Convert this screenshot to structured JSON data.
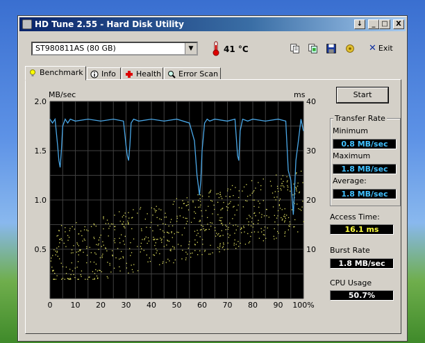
{
  "window": {
    "title": "HD Tune 2.55 - Hard Disk Utility",
    "controls": [
      "↓",
      "_",
      "□",
      "X"
    ]
  },
  "toolbar": {
    "drive": "ST980811AS (80 GB)",
    "temperature": "41 °C",
    "exit_label": "Exit",
    "icons": [
      "copy-text-icon",
      "copy-image-icon",
      "save-icon",
      "options-icon"
    ]
  },
  "tabs": [
    {
      "label": "Benchmark",
      "icon": "bulb-icon",
      "active": true
    },
    {
      "label": "Info",
      "icon": "info-icon",
      "active": false
    },
    {
      "label": "Health",
      "icon": "health-cross-icon",
      "active": false
    },
    {
      "label": "Error Scan",
      "icon": "magnifier-icon",
      "active": false
    }
  ],
  "start_label": "Start",
  "stats": {
    "group_title": "Transfer Rate",
    "minimum_label": "Minimum",
    "minimum_value": "0.8 MB/sec",
    "maximum_label": "Maximum",
    "maximum_value": "1.8 MB/sec",
    "average_label": "Average:",
    "average_value": "1.8 MB/sec",
    "access_label": "Access Time:",
    "access_value": "16.1 ms",
    "burst_label": "Burst Rate",
    "burst_value": "1.8 MB/sec",
    "cpu_label": "CPU Usage",
    "cpu_value": "50.7%"
  },
  "colors": {
    "transfer_line": "#4aa8e8",
    "access_points": "#e0e060",
    "plot_bg": "#000000",
    "grid": "#404040"
  },
  "chart_data": {
    "type": "line",
    "xlabel_ticks": [
      "0",
      "10",
      "20",
      "30",
      "40",
      "50",
      "60",
      "70",
      "80",
      "90",
      "100%"
    ],
    "y_left_label": "MB/sec",
    "y_left_ticks": [
      "2.0",
      "1.5",
      "1.0",
      "0.5"
    ],
    "y_left_range": [
      0,
      2.0
    ],
    "y_right_label": "ms",
    "y_right_ticks": [
      "40",
      "30",
      "20",
      "10"
    ],
    "y_right_range": [
      0,
      40
    ],
    "x_range": [
      0,
      100
    ],
    "grid": true,
    "series": [
      {
        "x": [
          0,
          1,
          2,
          3,
          3.5,
          4,
          4.5,
          5,
          6,
          7,
          8,
          10,
          15,
          20,
          25,
          29,
          30,
          30.5,
          31,
          31.5,
          32,
          33,
          35,
          40,
          45,
          50,
          55,
          57,
          58,
          59,
          59.5,
          60,
          61,
          62,
          63,
          65,
          70,
          73,
          74,
          74.5,
          75,
          76,
          78,
          80,
          85,
          90,
          93,
          94,
          95,
          96,
          97,
          98,
          99,
          100
        ],
        "y": [
          1.82,
          1.78,
          1.82,
          1.55,
          1.4,
          1.33,
          1.5,
          1.75,
          1.82,
          1.78,
          1.82,
          1.8,
          1.82,
          1.8,
          1.82,
          1.8,
          1.55,
          1.45,
          1.4,
          1.55,
          1.78,
          1.82,
          1.8,
          1.82,
          1.8,
          1.82,
          1.78,
          1.6,
          1.25,
          1.05,
          1.2,
          1.5,
          1.78,
          1.82,
          1.8,
          1.82,
          1.8,
          1.82,
          1.45,
          1.4,
          1.7,
          1.82,
          1.8,
          1.82,
          1.8,
          1.82,
          1.8,
          1.3,
          1.2,
          0.85,
          1.4,
          1.6,
          1.82,
          1.7
        ]
      }
    ]
  }
}
